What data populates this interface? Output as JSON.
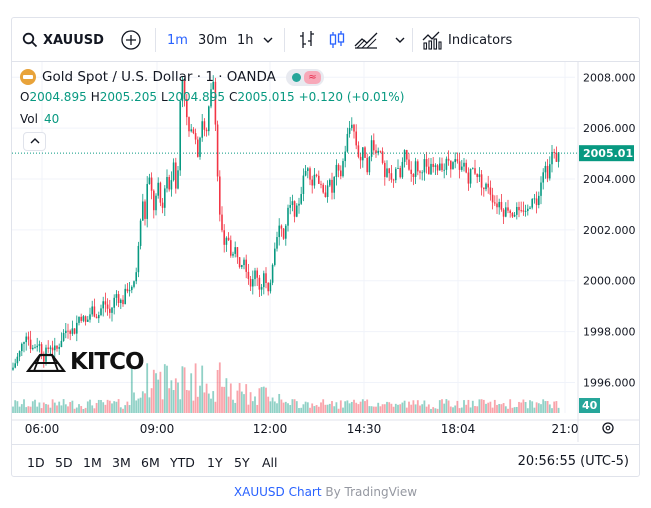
{
  "toolbar": {
    "symbol": "XAUUSD",
    "intervals": [
      "1m",
      "30m",
      "1h"
    ],
    "active_interval": "1m",
    "indicators_label": "Indicators"
  },
  "legend": {
    "title": "Gold Spot / U.S. Dollar · 1 · OANDA",
    "open_label": "O",
    "open": "2004.895",
    "high_label": "H",
    "high": "2005.205",
    "low_label": "L",
    "low": "2004.895",
    "close_label": "C",
    "close": "2005.015",
    "change": "+0.120 (+0.01%)",
    "vol_label": "Vol",
    "vol": "40"
  },
  "watermark": {
    "brand": "KITCO"
  },
  "bottom": {
    "ranges": [
      "1D",
      "5D",
      "1M",
      "3M",
      "6M",
      "YTD",
      "1Y",
      "5Y",
      "All"
    ],
    "clock": "20:56:55 (UTC-5)"
  },
  "footer": {
    "link": "XAUUSD Chart",
    "by": "By TradingView"
  },
  "colors": {
    "up": "#089981",
    "down": "#f23645",
    "accent": "#2962ff"
  },
  "chart_data": {
    "type": "candlestick",
    "title": "Gold Spot / U.S. Dollar · 1 · OANDA",
    "y_ticks": [
      "2008.000",
      "2006.000",
      "2004.000",
      "2002.000",
      "2000.000",
      "1998.000",
      "1996.000"
    ],
    "ylim": [
      1994.8,
      2008.6
    ],
    "x_ticks": [
      "06:00",
      "09:00",
      "12:00",
      "14:30",
      "18:04",
      "21:0"
    ],
    "current_price": "2005.015",
    "volume_label": "40",
    "price_path": [
      [
        0,
        1996.5
      ],
      [
        8,
        1997.2
      ],
      [
        14,
        1998.0
      ],
      [
        20,
        1997.3
      ],
      [
        26,
        1997.6
      ],
      [
        32,
        1997.0
      ],
      [
        38,
        1997.5
      ],
      [
        44,
        1997.2
      ],
      [
        50,
        1997.8
      ],
      [
        56,
        1998.2
      ],
      [
        62,
        1998.0
      ],
      [
        68,
        1998.7
      ],
      [
        74,
        1998.3
      ],
      [
        80,
        1998.9
      ],
      [
        86,
        1998.6
      ],
      [
        92,
        1999.2
      ],
      [
        98,
        1998.7
      ],
      [
        104,
        1999.5
      ],
      [
        110,
        1999.1
      ],
      [
        116,
        1999.8
      ],
      [
        120,
        1999.6
      ],
      [
        124,
        2000.3
      ],
      [
        127,
        2001.5
      ],
      [
        130,
        2003.2
      ],
      [
        133,
        2002.5
      ],
      [
        136,
        2004.2
      ],
      [
        139,
        2003.6
      ],
      [
        142,
        2002.8
      ],
      [
        146,
        2003.7
      ],
      [
        150,
        2002.6
      ],
      [
        154,
        2004.3
      ],
      [
        158,
        2003.5
      ],
      [
        162,
        2005.0
      ],
      [
        165,
        2002.9
      ],
      [
        168,
        2007.0
      ],
      [
        171,
        2008.2
      ],
      [
        174,
        2006.5
      ],
      [
        178,
        2005.6
      ],
      [
        182,
        2006.1
      ],
      [
        186,
        2005.0
      ],
      [
        190,
        2006.4
      ],
      [
        194,
        2005.5
      ],
      [
        198,
        2007.2
      ],
      [
        202,
        2008.0
      ],
      [
        205,
        2004.5
      ],
      [
        208,
        2002.5
      ],
      [
        212,
        2001.2
      ],
      [
        216,
        2001.8
      ],
      [
        220,
        2000.9
      ],
      [
        224,
        2001.3
      ],
      [
        228,
        2000.7
      ],
      [
        232,
        2001.0
      ],
      [
        236,
        2000.2
      ],
      [
        240,
        1999.8
      ],
      [
        244,
        2000.5
      ],
      [
        248,
        1999.6
      ],
      [
        252,
        2000.3
      ],
      [
        256,
        1999.3
      ],
      [
        260,
        2000.6
      ],
      [
        264,
        2001.8
      ],
      [
        268,
        2002.2
      ],
      [
        272,
        2001.6
      ],
      [
        276,
        2002.7
      ],
      [
        280,
        2003.0
      ],
      [
        284,
        2002.6
      ],
      [
        288,
        2003.3
      ],
      [
        292,
        2004.1
      ],
      [
        296,
        2004.6
      ],
      [
        300,
        2003.8
      ],
      [
        304,
        2004.4
      ],
      [
        308,
        2003.7
      ],
      [
        312,
        2003.2
      ],
      [
        316,
        2004.0
      ],
      [
        320,
        2003.5
      ],
      [
        324,
        2004.4
      ],
      [
        328,
        2004.0
      ],
      [
        332,
        2004.9
      ],
      [
        336,
        2005.8
      ],
      [
        340,
        2006.3
      ],
      [
        344,
        2005.4
      ],
      [
        348,
        2004.7
      ],
      [
        352,
        2005.2
      ],
      [
        356,
        2004.3
      ],
      [
        360,
        2005.6
      ],
      [
        364,
        2005.0
      ],
      [
        368,
        2005.4
      ],
      [
        372,
        2003.9
      ],
      [
        376,
        2004.3
      ],
      [
        380,
        2003.8
      ],
      [
        384,
        2004.5
      ],
      [
        388,
        2004.0
      ],
      [
        392,
        2005.0
      ],
      [
        396,
        2004.6
      ],
      [
        400,
        2004.1
      ],
      [
        404,
        2004.6
      ],
      [
        408,
        2004.2
      ],
      [
        412,
        2004.7
      ],
      [
        416,
        2004.1
      ],
      [
        420,
        2004.5
      ],
      [
        424,
        2004.3
      ],
      [
        428,
        2004.7
      ],
      [
        432,
        2004.4
      ],
      [
        436,
        2004.8
      ],
      [
        440,
        2004.5
      ],
      [
        444,
        2004.7
      ],
      [
        448,
        2004.2
      ],
      [
        452,
        2004.6
      ],
      [
        456,
        2004.0
      ],
      [
        460,
        2004.4
      ],
      [
        464,
        2004.3
      ],
      [
        468,
        2004.0
      ],
      [
        472,
        2003.6
      ],
      [
        476,
        2003.8
      ],
      [
        480,
        2003.3
      ],
      [
        484,
        2003.0
      ],
      [
        488,
        2003.1
      ],
      [
        492,
        2002.7
      ],
      [
        496,
        2002.9
      ],
      [
        500,
        2002.6
      ],
      [
        504,
        2002.8
      ],
      [
        508,
        2002.5
      ],
      [
        512,
        2002.9
      ],
      [
        516,
        2002.7
      ],
      [
        520,
        2003.4
      ],
      [
        524,
        2003.0
      ],
      [
        528,
        2003.8
      ],
      [
        532,
        2004.6
      ],
      [
        536,
        2004.2
      ],
      [
        540,
        2005.0
      ],
      [
        544,
        2004.8
      ],
      [
        548,
        2005.02
      ]
    ]
  }
}
